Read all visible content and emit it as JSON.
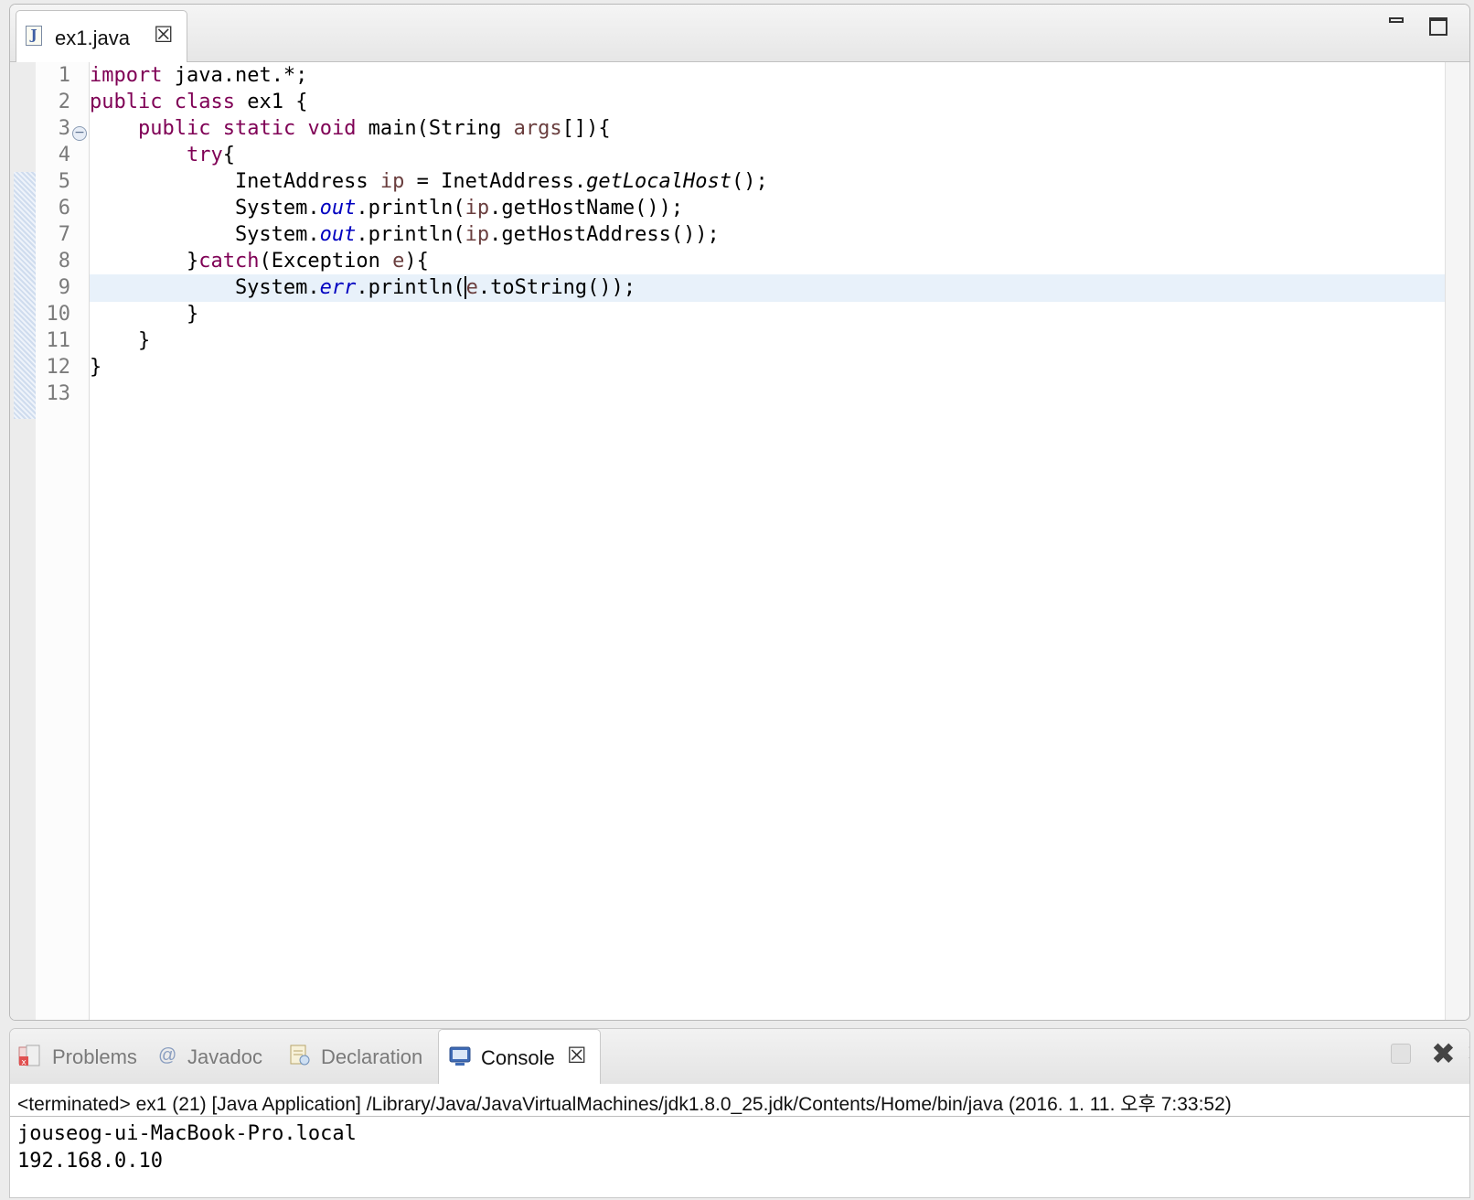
{
  "editor": {
    "tab": {
      "label": "ex1.java",
      "close_glyph": "☒",
      "icon": "java-file-icon"
    },
    "line_numbers": [
      "1",
      "2",
      "3",
      "4",
      "5",
      "6",
      "7",
      "8",
      "9",
      "10",
      "11",
      "12",
      "13"
    ],
    "code_lines": [
      "import java.net.*;",
      "public class ex1 {",
      "    public static void main(String args[]){",
      "        try{",
      "            InetAddress ip = InetAddress.getLocalHost();",
      "            System.out.println(ip.getHostName());",
      "            System.out.println(ip.getHostAddress());",
      "        }catch(Exception e){",
      "            System.err.println(e.toString());",
      "        }",
      "    }",
      "}",
      ""
    ],
    "current_line": 9,
    "colors": {
      "keyword": "#7f0055",
      "field": "#0000c0",
      "local_variable": "#6a3e3e",
      "current_line_bg": "#e8f1fa"
    }
  },
  "console": {
    "tabs": [
      {
        "label": "Problems",
        "icon": "problems-icon",
        "active": false
      },
      {
        "label": "Javadoc",
        "icon": "javadoc-at-icon",
        "active": false
      },
      {
        "label": "Declaration",
        "icon": "declaration-icon",
        "active": false
      },
      {
        "label": "Console",
        "icon": "console-monitor-icon",
        "active": true
      }
    ],
    "close_glyph": "☒",
    "description": "<terminated> ex1 (21) [Java Application] /Library/Java/JavaVirtualMachines/jdk1.8.0_25.jdk/Contents/Home/bin/java (2016. 1. 11. 오후 7:33:52)",
    "output": [
      "jouseog-ui-MacBook-Pro.local",
      "192.168.0.10"
    ]
  }
}
